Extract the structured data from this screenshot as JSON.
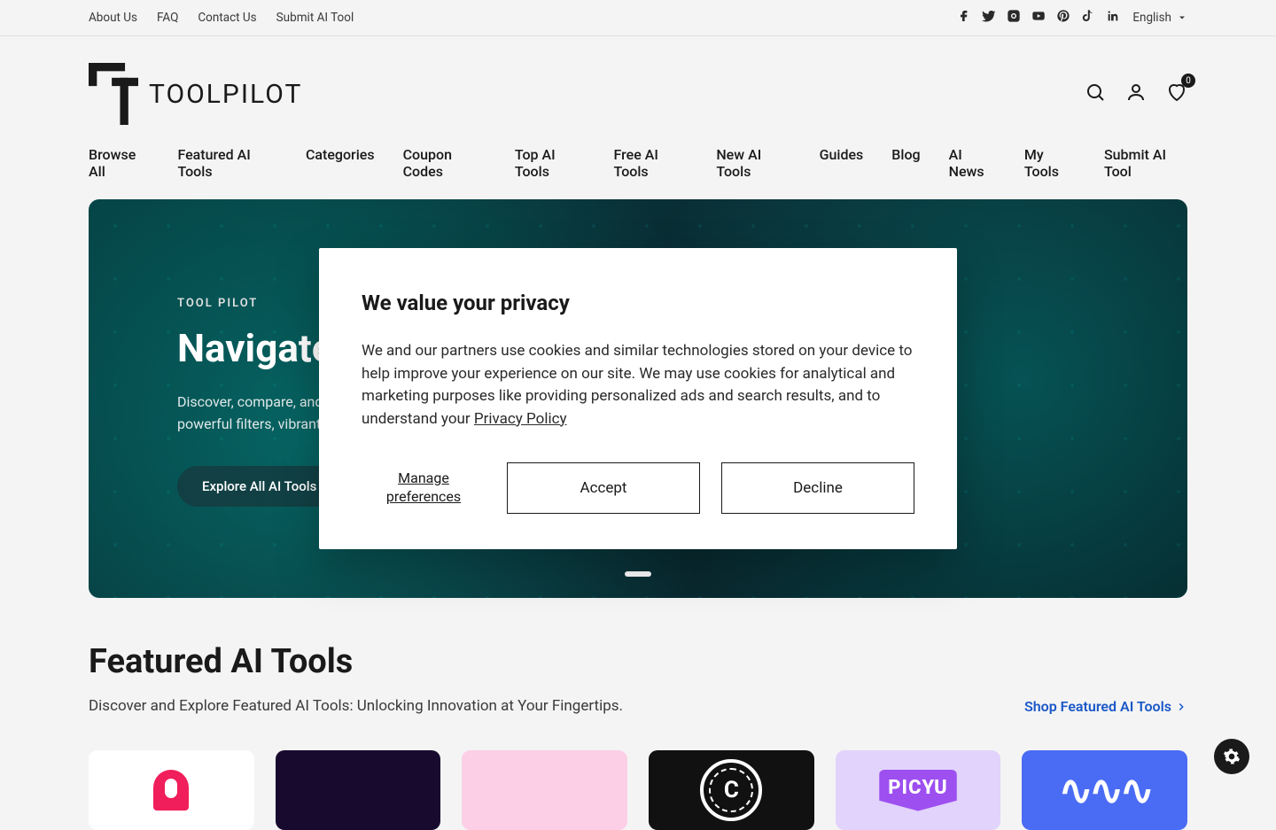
{
  "topbar": {
    "links": [
      "About Us",
      "FAQ",
      "Contact Us",
      "Submit AI Tool"
    ],
    "social": [
      "facebook",
      "twitter",
      "instagram",
      "youtube",
      "pinterest",
      "tiktok",
      "linkedin"
    ],
    "language": "English"
  },
  "header": {
    "logo_text": "TOOLPILOT",
    "wishlist_count": "0"
  },
  "nav": {
    "items": [
      "Browse All",
      "Featured AI Tools",
      "Categories",
      "Coupon Codes",
      "Top AI Tools",
      "Free AI Tools",
      "New AI Tools",
      "Guides",
      "Blog",
      "AI News",
      "My Tools",
      "Submit AI Tool"
    ]
  },
  "hero": {
    "eyebrow": "TOOL PILOT",
    "title": "Navigate th",
    "desc_line1": "Discover, compare, and exc",
    "desc_line2": "powerful filters, vibrant com",
    "button": "Explore All AI Tools"
  },
  "featured": {
    "title": "Featured AI Tools",
    "desc": "Discover and Explore Featured AI Tools: Unlocking Innovation at Your Fingertips.",
    "link": "Shop Featured AI Tools",
    "card5_label": "PICYU",
    "card6_label": "∿∿∿"
  },
  "modal": {
    "title": "We value your privacy",
    "body_before": "We and our partners use cookies and similar technologies stored on your device to help improve your experience on our site. We may use cookies for analytical and marketing purposes like providing personalized ads and search results, and to understand your ",
    "policy": "Privacy Policy",
    "manage": "Manage preferences",
    "accept": "Accept",
    "decline": "Decline"
  }
}
